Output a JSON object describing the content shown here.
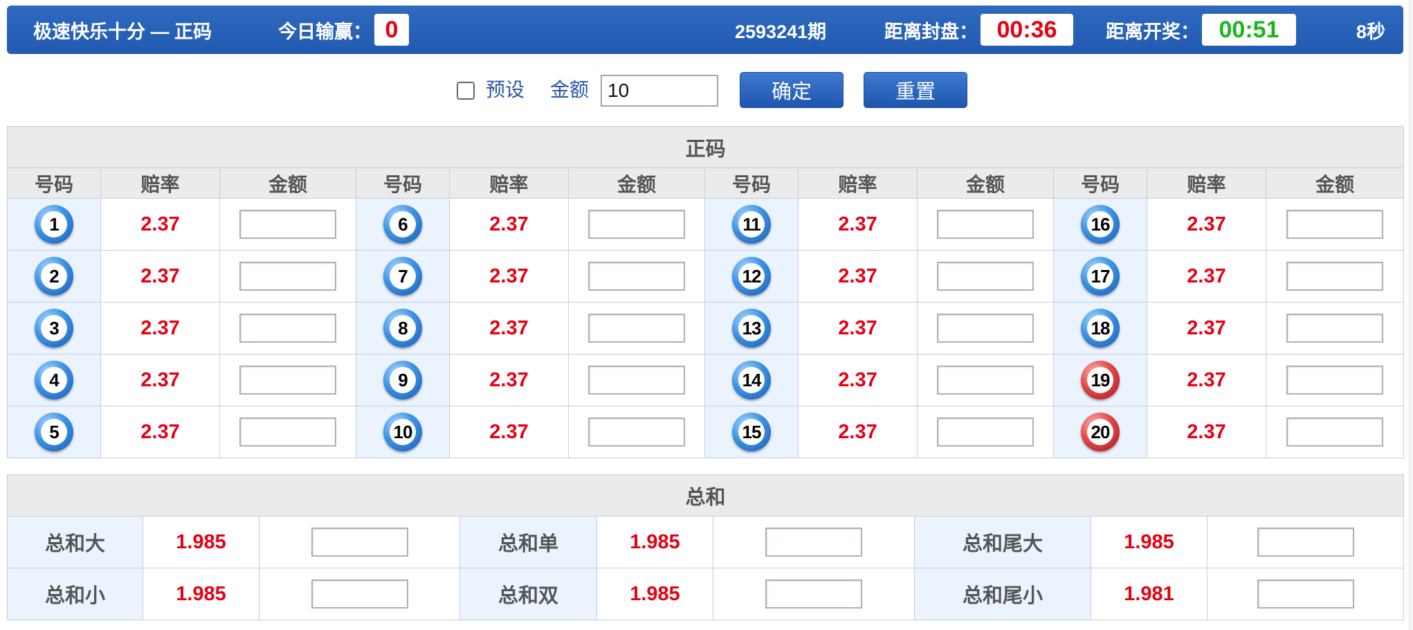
{
  "header": {
    "title": "极速快乐十分 — 正码",
    "winloss_label": "今日输赢：",
    "winloss_value": "0",
    "period": "2593241期",
    "close_label": "距离封盘：",
    "close_time": "00:36",
    "open_label": "距离开奖：",
    "open_time": "00:51",
    "refresh": "8秒",
    "colors": {
      "bar": "#2760b6",
      "red": "#e60012",
      "green": "#1bb51b"
    }
  },
  "toolbar": {
    "preset_label": "预设",
    "amount_label": "金额",
    "amount_value": "10",
    "confirm_label": "确定",
    "reset_label": "重置"
  },
  "main_table": {
    "title": "正码",
    "headers": [
      "号码",
      "赔率",
      "金额",
      "号码",
      "赔率",
      "金额",
      "号码",
      "赔率",
      "金额",
      "号码",
      "赔率",
      "金额"
    ],
    "rows": [
      [
        {
          "num": "1",
          "odds": "2.37",
          "color": "blue"
        },
        {
          "num": "6",
          "odds": "2.37",
          "color": "blue"
        },
        {
          "num": "11",
          "odds": "2.37",
          "color": "blue"
        },
        {
          "num": "16",
          "odds": "2.37",
          "color": "blue"
        }
      ],
      [
        {
          "num": "2",
          "odds": "2.37",
          "color": "blue"
        },
        {
          "num": "7",
          "odds": "2.37",
          "color": "blue"
        },
        {
          "num": "12",
          "odds": "2.37",
          "color": "blue"
        },
        {
          "num": "17",
          "odds": "2.37",
          "color": "blue"
        }
      ],
      [
        {
          "num": "3",
          "odds": "2.37",
          "color": "blue"
        },
        {
          "num": "8",
          "odds": "2.37",
          "color": "blue"
        },
        {
          "num": "13",
          "odds": "2.37",
          "color": "blue"
        },
        {
          "num": "18",
          "odds": "2.37",
          "color": "blue"
        }
      ],
      [
        {
          "num": "4",
          "odds": "2.37",
          "color": "blue"
        },
        {
          "num": "9",
          "odds": "2.37",
          "color": "blue"
        },
        {
          "num": "14",
          "odds": "2.37",
          "color": "blue"
        },
        {
          "num": "19",
          "odds": "2.37",
          "color": "red"
        }
      ],
      [
        {
          "num": "5",
          "odds": "2.37",
          "color": "blue"
        },
        {
          "num": "10",
          "odds": "2.37",
          "color": "blue"
        },
        {
          "num": "15",
          "odds": "2.37",
          "color": "blue"
        },
        {
          "num": "20",
          "odds": "2.37",
          "color": "red"
        }
      ]
    ]
  },
  "sum_table": {
    "title": "总和",
    "rows": [
      [
        {
          "label": "总和大",
          "odds": "1.985"
        },
        {
          "label": "总和单",
          "odds": "1.985"
        },
        {
          "label": "总和尾大",
          "odds": "1.985"
        }
      ],
      [
        {
          "label": "总和小",
          "odds": "1.985"
        },
        {
          "label": "总和双",
          "odds": "1.985"
        },
        {
          "label": "总和尾小",
          "odds": "1.981"
        }
      ]
    ]
  }
}
